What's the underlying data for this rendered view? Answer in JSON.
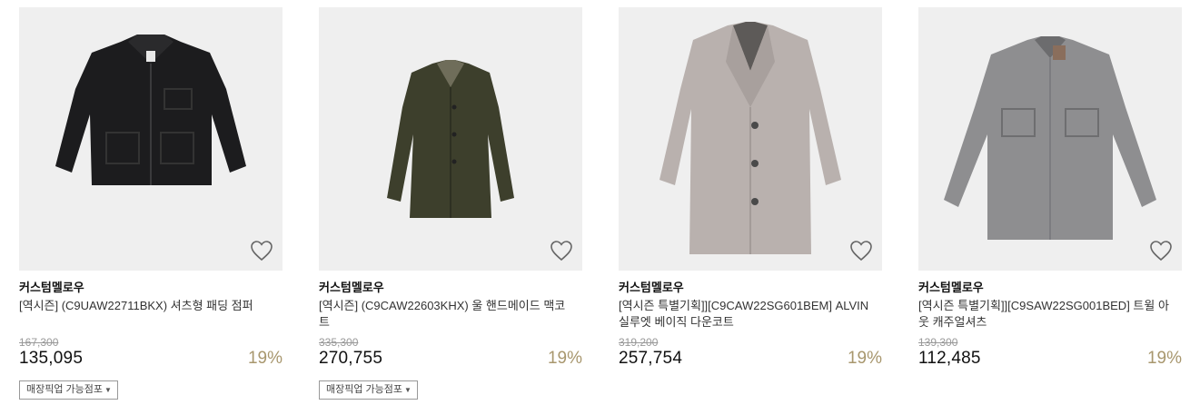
{
  "products": [
    {
      "brand": "커스텀멜로우",
      "name": "[역시즌] (C9UAW22711BKX) 셔츠형 패딩 점퍼",
      "original_price": "167,300",
      "sale_price": "135,095",
      "discount": "19%",
      "pickup_label": "매장픽업 가능점포",
      "image_color": "#1c1c1e",
      "icon": "heart-icon"
    },
    {
      "brand": "커스텀멜로우",
      "name": "[역시즌] (C9CAW22603KHX) 울 핸드메이드 맥코트",
      "original_price": "335,300",
      "sale_price": "270,755",
      "discount": "19%",
      "pickup_label": "매장픽업 가능점포",
      "image_color": "#3d3f2c",
      "icon": "heart-icon"
    },
    {
      "brand": "커스텀멜로우",
      "name": "[역시즌 특별기획]][C9CAW22SG601BEM] ALVIN 실루엣 베이직 다운코트",
      "original_price": "319,200",
      "sale_price": "257,754",
      "discount": "19%",
      "image_color": "#b9b1ae",
      "icon": "heart-icon"
    },
    {
      "brand": "커스텀멜로우",
      "name": "[역시즌 특별기획]][C9SAW22SG001BED] 트윌 아웃 캐주얼셔츠",
      "original_price": "139,300",
      "sale_price": "112,485",
      "discount": "19%",
      "image_color": "#8e8e90",
      "icon": "heart-icon"
    }
  ]
}
